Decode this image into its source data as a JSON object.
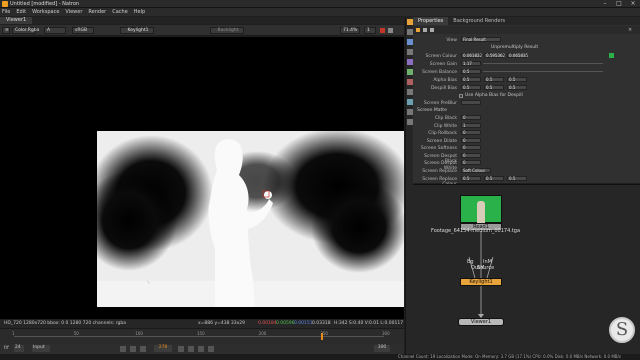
{
  "window": {
    "title": "Untitled [modified] - Natron"
  },
  "menubar": {
    "items": [
      "File",
      "Edit",
      "Workspace",
      "Viewer",
      "Render",
      "Cache",
      "Help"
    ]
  },
  "viewer": {
    "tab_label": "Viewer1",
    "layer": "Color.Rgba",
    "channel": "A",
    "colorspace": "sRGB",
    "input_a": "Keylight1",
    "input_b": "Backlight",
    "zoom": "71.4%",
    "frame_label": "1",
    "info_left": "HD_720 1280x720  bbox: 0 0 1280 720  channels: rgba",
    "info_coords": "x=886 y=438 33x29",
    "info_r": "0.00184",
    "info_g": "0.00596",
    "info_b": "0.00151",
    "info_a": "0.03318",
    "info_hsvl": "H:342 S:0.40 V:0.01  L:0.00117",
    "fps_label": "f/f",
    "fps_value": "24",
    "playback_mode": "Input",
    "frame_current": "278",
    "timeline_ticks": [
      "1",
      "50",
      "100",
      "150",
      "200",
      "250",
      "300"
    ],
    "timeline_progress": 0.83,
    "range_end": "300"
  },
  "properties": {
    "tabs": [
      "Properties",
      "Background Renders"
    ],
    "view_label": "View",
    "view_value": "Final Result",
    "unpremultiply_label": "Unpremultiply Result",
    "params": [
      {
        "label": "Screen Colour",
        "values": [
          "0.061822",
          "0.595362",
          "0.065835"
        ]
      },
      {
        "label": "Screen Gain",
        "values": [
          "1.17"
        ]
      },
      {
        "label": "Screen Balance",
        "values": [
          "0.5"
        ]
      },
      {
        "label": "Alpha Bias",
        "values": [
          "0.5",
          "0.5",
          "0.5"
        ]
      },
      {
        "label": "Despill Bias",
        "values": [
          "0.5",
          "0.5",
          "0.5"
        ]
      }
    ],
    "use_alpha_bias": "Use Alpha Bias for Despill",
    "prematte_label": "Screen PreBlur",
    "screen_matte_label": "Screen Matte",
    "matte_params": [
      "Clip Black",
      "Clip White",
      "Clip Rollback",
      "Screen Dilate",
      "Screen Softness",
      "Screen Despot Black",
      "Screen Despot White"
    ],
    "matte_values": [
      "0",
      "1",
      "0",
      "0",
      "0",
      "0",
      "0"
    ],
    "replace_label": "Screen Replace",
    "replace_value": "Soft Colour",
    "replace_colour_label": "Screen Replace Colour",
    "replace_colour_values": [
      "0.5",
      "0.5",
      "0.5"
    ]
  },
  "nodegraph": {
    "read_node": "Read1",
    "read_file": "Footage_64154-medium_00174.tga",
    "keylight_node": "Keylight1",
    "viewer_node": "Viewer1",
    "input_labels": [
      "Bg",
      "InM",
      "OutM",
      "Source"
    ]
  },
  "status": {
    "text": "Channel Count: 19  Localization Mode: On  Memory: 3.7 GB (17.1%)  CPU: 0.0%  Disk: 0.0 MB/s  Network: 0.0 MB/s"
  },
  "colors": {
    "accent": "#f0a020",
    "keylight": "#e8a43a",
    "green_screen": "#2bb14a",
    "timeline_marker": "#e88a1a"
  }
}
